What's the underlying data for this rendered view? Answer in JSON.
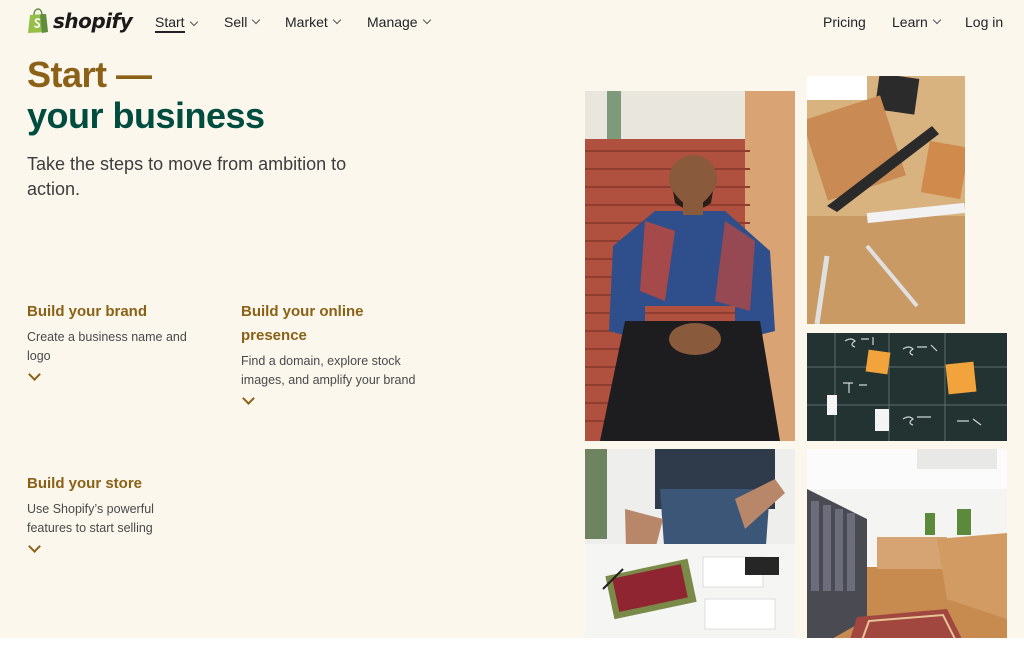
{
  "nav": {
    "logo_text": "shopify",
    "items": [
      {
        "label": "Start",
        "active": true
      },
      {
        "label": "Sell"
      },
      {
        "label": "Market"
      },
      {
        "label": "Manage"
      }
    ],
    "right": {
      "pricing": "Pricing",
      "learn": "Learn",
      "login": "Log in"
    }
  },
  "hero": {
    "line1": "Start —",
    "line2": "your business",
    "subtitle": "Take the steps to move from ambition to action."
  },
  "features": [
    {
      "title": "Build your brand",
      "desc": "Create a business name and logo"
    },
    {
      "title": "Build your online presence",
      "desc": "Find a domain, explore stock images, and amplify your brand"
    },
    {
      "title": "Build your store",
      "desc": "Use Shopify’s powerful features to start selling"
    }
  ],
  "colors": {
    "background": "#fbf7ed",
    "gold": "#8a6116",
    "green": "#004c3f",
    "logo_green": "#95bf47"
  },
  "images": [
    "man-on-stairs-photo",
    "notebooks-on-desk-photo",
    "chalkboard-sticky-notes-photo",
    "person-at-table-with-notebooks-photo",
    "clothing-store-interior-photo"
  ]
}
